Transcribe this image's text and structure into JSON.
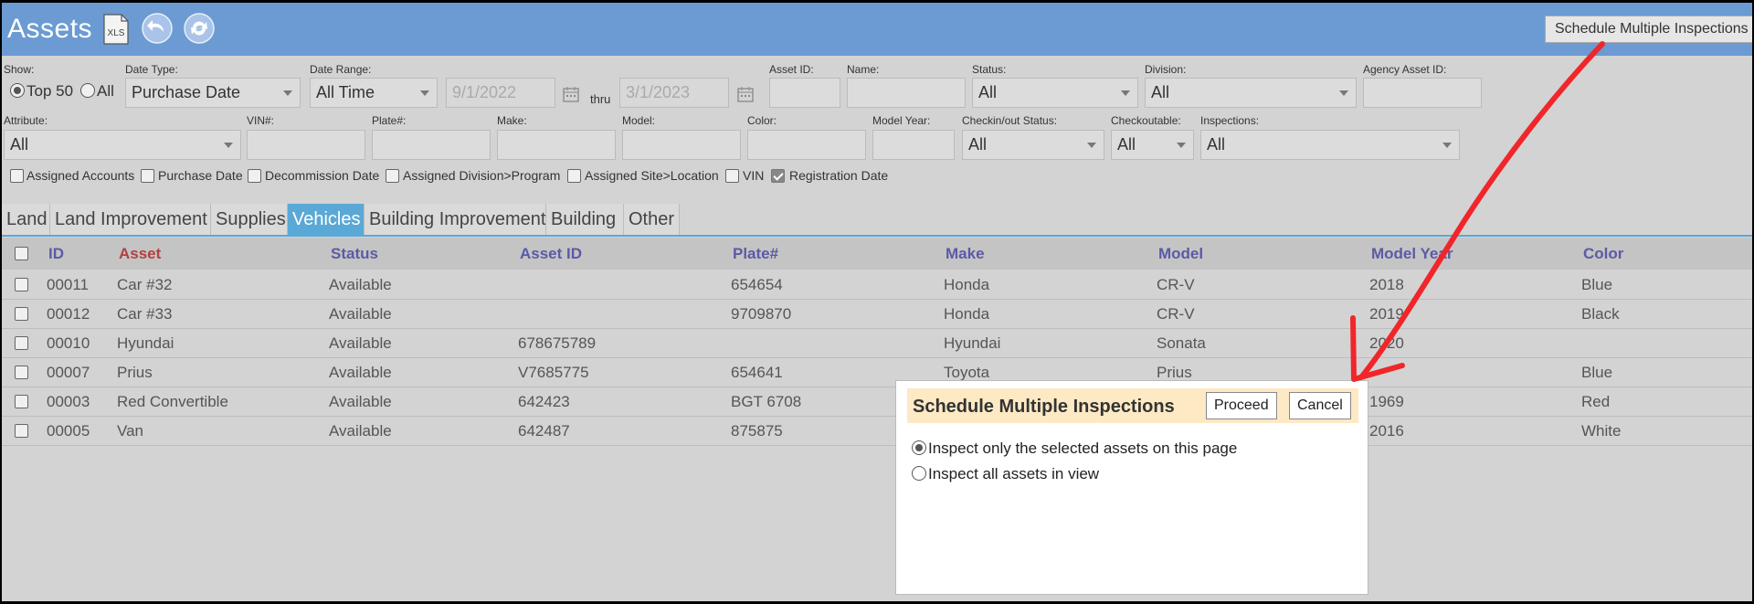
{
  "header": {
    "title": "Assets",
    "export_label": "XLS",
    "schedule_button": "Schedule Multiple Inspections",
    "icons": [
      "xls-icon",
      "back-icon",
      "refresh-icon"
    ]
  },
  "filters": {
    "show_label": "Show:",
    "show_top50": "Top 50",
    "show_all": "All",
    "date_type_label": "Date Type:",
    "date_type_value": "Purchase Date",
    "date_range_label": "Date Range:",
    "date_range_value": "All Time",
    "date_from": "9/1/2022",
    "thru_label": "thru",
    "date_to": "3/1/2023",
    "asset_id_label": "Asset ID:",
    "name_label": "Name:",
    "status_label": "Status:",
    "status_value": "All",
    "division_label": "Division:",
    "division_value": "All",
    "agency_asset_id_label": "Agency Asset ID:",
    "attribute_label": "Attribute:",
    "attribute_value": "All",
    "vin_label": "VIN#:",
    "plate_label": "Plate#:",
    "make_label": "Make:",
    "model_label": "Model:",
    "color_label": "Color:",
    "model_year_label": "Model Year:",
    "checkinout_label": "Checkin/out Status:",
    "checkinout_value": "All",
    "checkoutable_label": "Checkoutable:",
    "checkoutable_value": "All",
    "inspections_label": "Inspections:",
    "inspections_value": "All"
  },
  "columns_toggle": [
    {
      "label": "Assigned Accounts",
      "checked": false
    },
    {
      "label": "Purchase Date",
      "checked": false
    },
    {
      "label": "Decommission Date",
      "checked": false
    },
    {
      "label": "Assigned Division>Program",
      "checked": false
    },
    {
      "label": "Assigned Site>Location",
      "checked": false
    },
    {
      "label": "VIN",
      "checked": false
    },
    {
      "label": "Registration Date",
      "checked": true
    }
  ],
  "tabs": [
    {
      "label": "Land",
      "active": false
    },
    {
      "label": "Land Improvement",
      "active": false
    },
    {
      "label": "Supplies",
      "active": false
    },
    {
      "label": "Vehicles",
      "active": true
    },
    {
      "label": "Building Improvement",
      "active": false
    },
    {
      "label": "Building",
      "active": false
    },
    {
      "label": "Other",
      "active": false
    }
  ],
  "table": {
    "headers": [
      "ID",
      "Asset",
      "Status",
      "Asset ID",
      "Plate#",
      "Make",
      "Model",
      "Model Year",
      "Color"
    ],
    "rows": [
      [
        "00011",
        "Car #32",
        "Available",
        "",
        "654654",
        "Honda",
        "CR-V",
        "2018",
        "Blue"
      ],
      [
        "00012",
        "Car #33",
        "Available",
        "",
        "9709870",
        "Honda",
        "CR-V",
        "2019",
        "Black"
      ],
      [
        "00010",
        "Hyundai",
        "Available",
        "678675789",
        "",
        "Hyundai",
        "Sonata",
        "2020",
        ""
      ],
      [
        "00007",
        "Prius",
        "Available",
        "V7685775",
        "654641",
        "Toyota",
        "Prius",
        "",
        "Blue"
      ],
      [
        "00003",
        "Red Convertible",
        "Available",
        "642423",
        "BGT 6708",
        "",
        "",
        "1969",
        "Red"
      ],
      [
        "00005",
        "Van",
        "Available",
        "642487",
        "875875",
        "",
        "",
        "2016",
        "White"
      ]
    ]
  },
  "modal": {
    "title": "Schedule Multiple Inspections",
    "proceed": "Proceed",
    "cancel": "Cancel",
    "option_selected": "Inspect only the selected assets on this page",
    "option_all": "Inspect all assets in view",
    "selected_option": 0
  },
  "colors": {
    "header_bg": "#6b9bd2",
    "active_tab": "#5aa8d6",
    "modal_head": "#fde9c4",
    "annotation_arrow": "#f0262a"
  }
}
